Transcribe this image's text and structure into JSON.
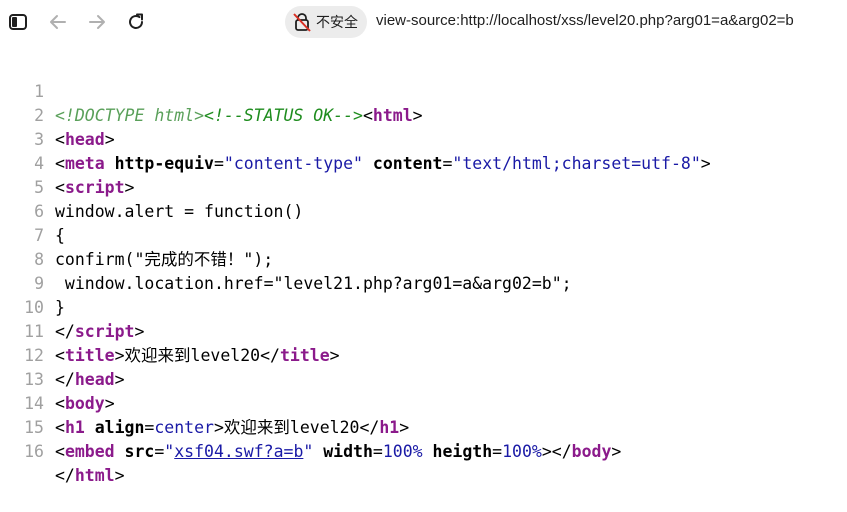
{
  "toolbar": {
    "security_label": "不安全",
    "url": "view-source:http://localhost/xss/level20.php?arg01=a&arg02=b"
  },
  "source": {
    "line_numbers": [
      "1",
      "2",
      "3",
      "4",
      "5",
      "6",
      "7",
      "8",
      "9",
      "10",
      "11",
      "12",
      "13",
      "14",
      "15",
      "16"
    ],
    "line1": {
      "doctype": "<!DOCTYPE html>",
      "comment": "<!--STATUS OK-->",
      "open": "<",
      "tag": "html",
      "close": ">"
    },
    "line2": {
      "open": "<",
      "tag": "head",
      "close": ">"
    },
    "line3": {
      "open": "<",
      "tag": "meta",
      "sp1": " ",
      "attr1": "http-equiv",
      "eq1": "=",
      "val1": "\"content-type\"",
      "sp2": " ",
      "attr2": "content",
      "eq2": "=",
      "val2": "\"text/html;charset=utf-8\"",
      "close": ">"
    },
    "line4": {
      "open": "<",
      "tag": "script",
      "close": ">"
    },
    "line5": "window.alert = function()",
    "line6": "{",
    "line7": "confirm(\"完成的不错！\");",
    "line8": " window.location.href=\"level21.php?arg01=a&arg02=b\";",
    "line9": "}",
    "line10": {
      "open": "</",
      "tag": "script",
      "close": ">"
    },
    "line11": {
      "open": "<",
      "tag": "title",
      "gt": ">",
      "text": "欢迎来到level20",
      "open2": "</",
      "tag2": "title",
      "close2": ">"
    },
    "line12": {
      "open": "</",
      "tag": "head",
      "close": ">"
    },
    "line13": {
      "open": "<",
      "tag": "body",
      "close": ">"
    },
    "line14": {
      "open": "<",
      "tag": "h1",
      "sp": " ",
      "attr": "align",
      "eq": "=",
      "val": "center",
      "gt": ">",
      "text": "欢迎来到level20",
      "open2": "</",
      "tag2": "h1",
      "close2": ">"
    },
    "line15": {
      "open": "<",
      "tag": "embed",
      "sp1": " ",
      "attr1": "src",
      "eq1": "=",
      "q1": "\"",
      "link": "xsf04.swf?a=b",
      "q2": "\"",
      "sp2": " ",
      "attr2": "width",
      "eq2": "=",
      "val2": "100%",
      "sp3": " ",
      "attr3": "heigth",
      "eq3": "=",
      "val3": "100%",
      "gt": ">",
      "open2": "</",
      "tag2": "body",
      "close2": ">"
    },
    "line16": {
      "open": "</",
      "tag": "html",
      "close": ">"
    }
  },
  "colors": {
    "tag": "#8b1a8b",
    "attr_value": "#1a1aa6",
    "comment": "#1e8c1e",
    "line_number": "#a0a0a0"
  },
  "icons": [
    "sidebar-toggle-icon",
    "back-arrow-icon",
    "forward-arrow-icon",
    "reload-icon",
    "not-secure-lock-icon"
  ]
}
